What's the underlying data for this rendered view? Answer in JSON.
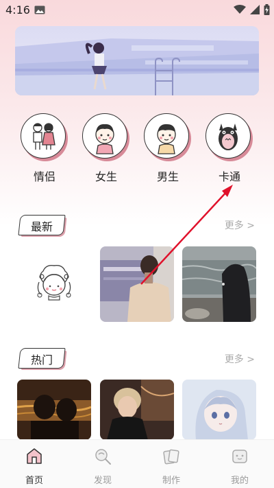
{
  "status": {
    "time": "4:16"
  },
  "categories": [
    {
      "label": "情侣",
      "icon": "couple-icon"
    },
    {
      "label": "女生",
      "icon": "girl-icon"
    },
    {
      "label": "男生",
      "icon": "boy-icon"
    },
    {
      "label": "卡通",
      "icon": "totoro-icon"
    }
  ],
  "sections": {
    "latest": {
      "title": "最新",
      "more": "更多 >"
    },
    "hot": {
      "title": "热门",
      "more": "更多 >"
    }
  },
  "nav": {
    "items": [
      {
        "label": "首页",
        "icon": "home-icon",
        "active": true
      },
      {
        "label": "发现",
        "icon": "discover-icon",
        "active": false
      },
      {
        "label": "制作",
        "icon": "make-icon",
        "active": false
      },
      {
        "label": "我的",
        "icon": "profile-icon",
        "active": false
      }
    ]
  },
  "colors": {
    "accent_shadow": "#d78a98",
    "annotation_arrow": "#e0112b",
    "nav_active": "#333333",
    "nav_inactive": "#9a9a9a"
  }
}
